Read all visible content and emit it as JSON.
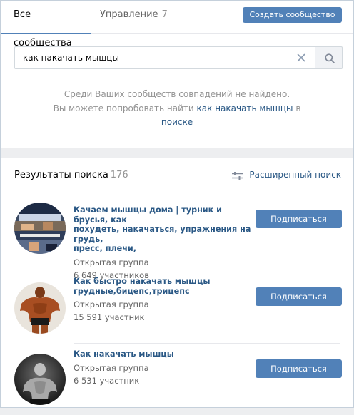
{
  "tabs": {
    "all_label": "Все сообщества",
    "manage_label": "Управление",
    "manage_count": "7"
  },
  "create_button": "Создать сообщество",
  "search": {
    "value": "как накачать мышцы"
  },
  "empty_message": {
    "line1": "Среди Ваших сообществ совпадений не найдено.",
    "line2_prefix": "Вы можете попробовать найти",
    "line2_link": "как накачать мышцы",
    "line2_in": "в",
    "line3_link": "поиске"
  },
  "results": {
    "title": "Результаты поиска",
    "count": "176",
    "advanced_label": "Расширенный поиск"
  },
  "groups": [
    {
      "name_line1": "Качаем мышцы дома | турник и брусья, как",
      "name_line2": "похудеть, накачаться, упражнения на грудь,",
      "name_line3": "пресс, плечи,",
      "type": "Открытая группа",
      "members": "6 649 участников",
      "button": "Подписаться"
    },
    {
      "name_line1": "Как быстро накачать мышцы",
      "name_line2": "грудные,бицепс,трицепс",
      "type": "Открытая группа",
      "members": "15 591 участник",
      "button": "Подписаться"
    },
    {
      "name_line1": "Как накачать мышцы",
      "type": "Открытая группа",
      "members": "6 531 участник",
      "button": "Подписаться"
    }
  ],
  "colors": {
    "accent": "#5181b8",
    "link": "#2a5885",
    "muted": "#939393",
    "highlight": "#d9e3f0"
  },
  "icons": {
    "clear": "close-icon",
    "search": "magnifier-icon",
    "advanced": "sliders-icon"
  }
}
